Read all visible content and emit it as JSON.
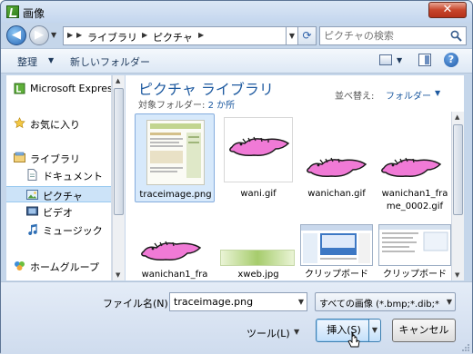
{
  "window": {
    "title": "画像",
    "close_label": "✕"
  },
  "address": {
    "crumbs": [
      "ライブラリ",
      "ピクチャ"
    ],
    "search_placeholder": "ピクチャの検索"
  },
  "toolbar": {
    "organize": "整理",
    "new_folder": "新しいフォルダー"
  },
  "nav": {
    "items": [
      {
        "label": "Microsoft Express",
        "icon": "office-icon"
      },
      {
        "label": "お気に入り",
        "icon": "star-icon"
      },
      {
        "label": "ライブラリ",
        "icon": "library-icon"
      },
      {
        "label": "ドキュメント",
        "icon": "document-icon"
      },
      {
        "label": "ピクチャ",
        "icon": "picture-icon",
        "selected": true
      },
      {
        "label": "ビデオ",
        "icon": "video-icon"
      },
      {
        "label": "ミュージック",
        "icon": "music-icon"
      },
      {
        "label": "ホームグループ",
        "icon": "homegroup-icon"
      }
    ]
  },
  "library": {
    "title": "ピクチャ ライブラリ",
    "target_label": "対象フォルダー:",
    "target_link": "2 か所",
    "arrange_label": "並べ替え:",
    "arrange_value": "フォルダー"
  },
  "files": [
    {
      "name": "traceimage.png",
      "selected": true
    },
    {
      "name": "wani.gif"
    },
    {
      "name": "wanichan.gif"
    },
    {
      "name_line1": "wanichan1_fra",
      "name_line2": "me_0002.gif"
    },
    {
      "name": "wanichan1_fra"
    },
    {
      "name": "xweb.jpg"
    },
    {
      "name": "クリップボード"
    },
    {
      "name": "クリップボード"
    }
  ],
  "bottom": {
    "filename_label": "ファイル名(N):",
    "filename_value": "traceimage.png",
    "filter_value": "すべての画像 (*.bmp;*.dib;*",
    "tools_label": "ツール(L)",
    "insert_label": "挿入(S)",
    "cancel_label": "キャンセル"
  },
  "colors": {
    "accent": "#1e5aa0",
    "selection": "#cce3f8",
    "croc": "#f07ad6"
  }
}
